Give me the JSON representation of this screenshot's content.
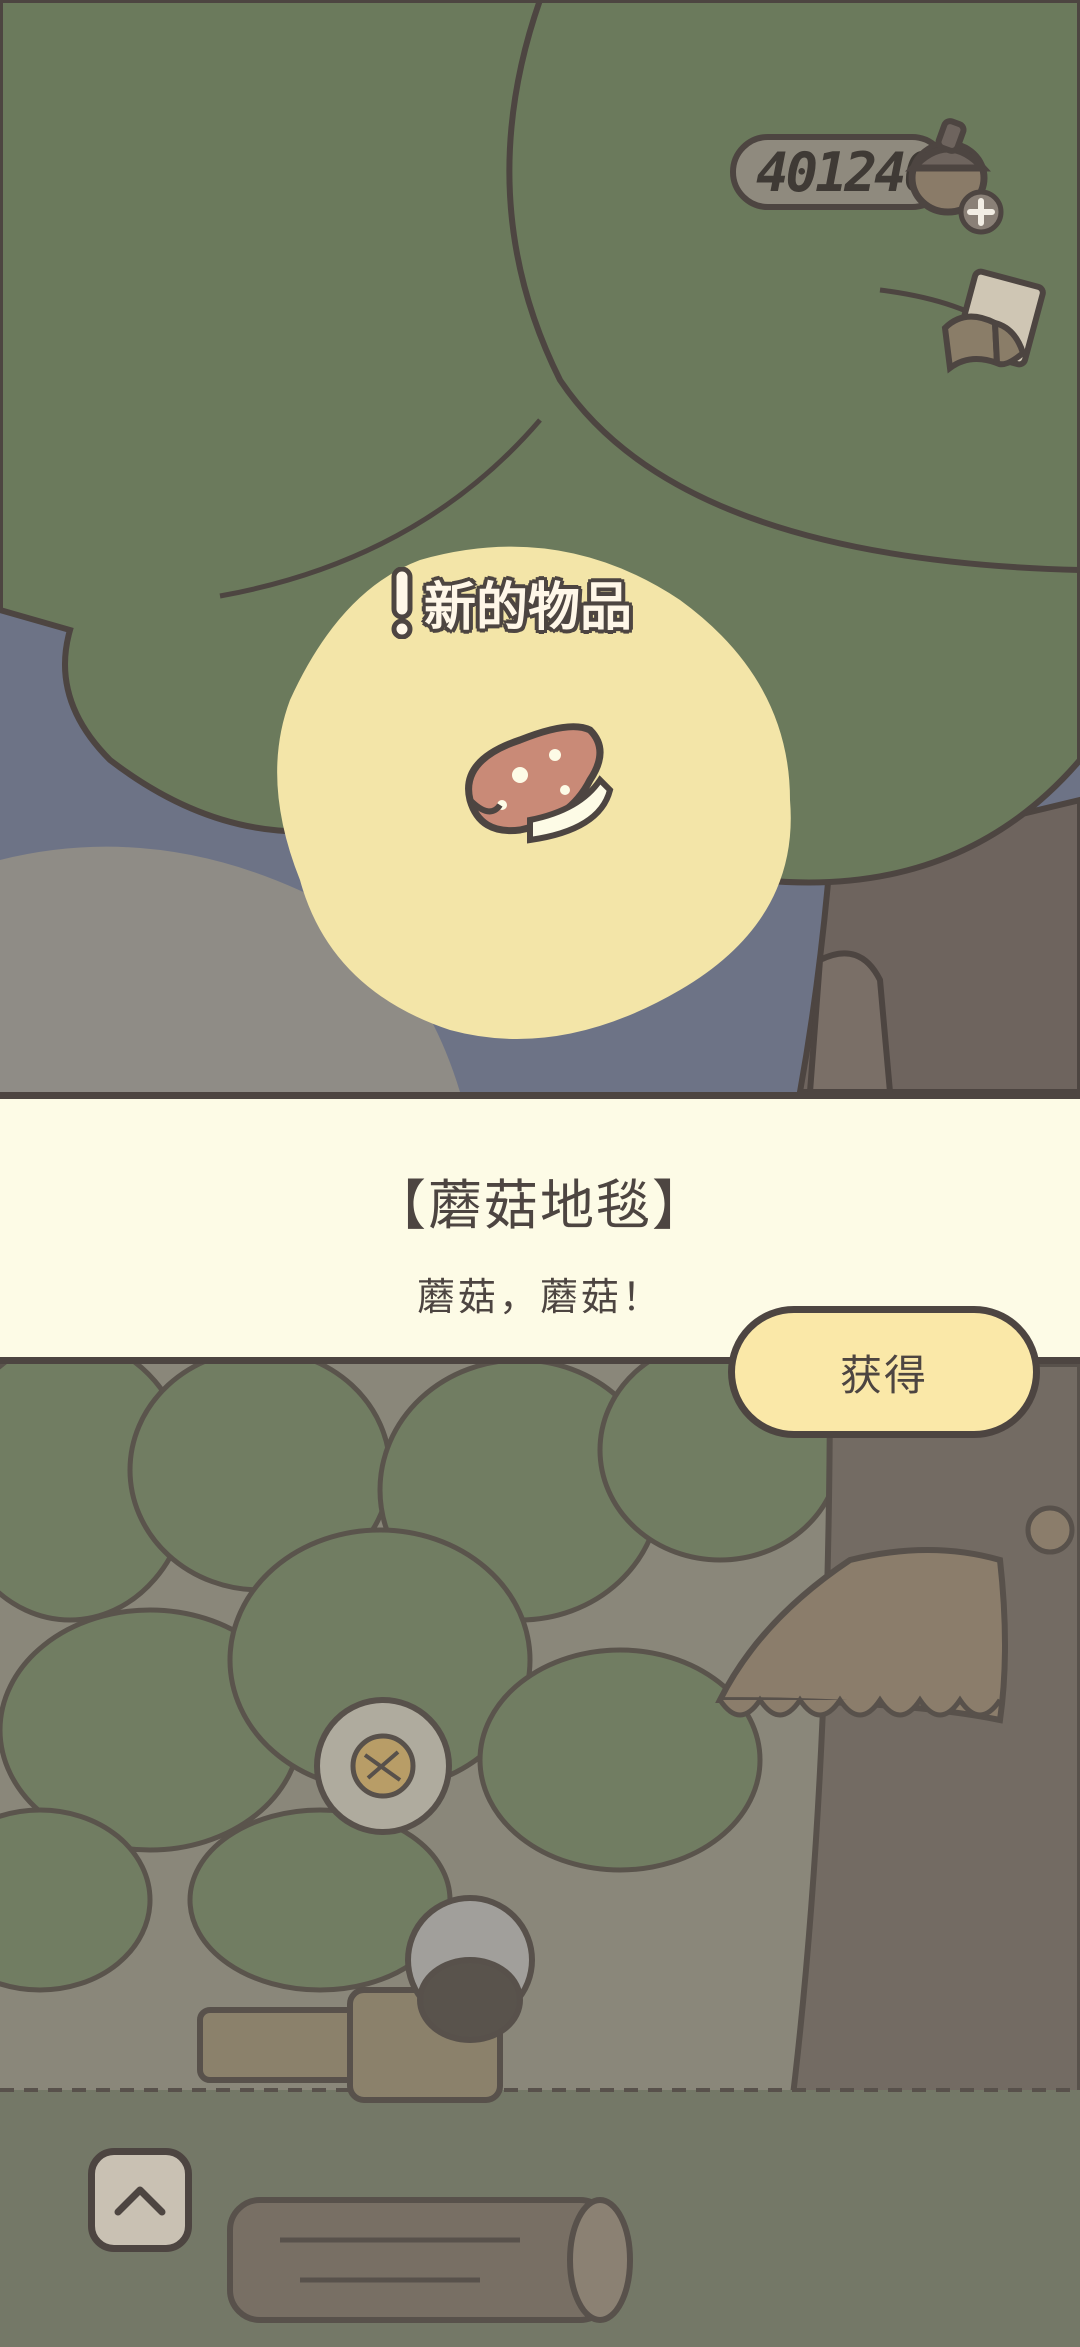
{
  "hud": {
    "currency_value": "401240",
    "currency_icon": "acorn-icon",
    "add_icon": "plus-icon",
    "notebook_icon": "note-icon"
  },
  "popup": {
    "badge_icon": "exclamation-icon",
    "badge_text": "新的物品",
    "item_icon": "mushroom-rug-icon",
    "item_name": "【蘑菇地毯】",
    "item_description": "蘑菇，蘑菇！",
    "obtain_button": "获得"
  },
  "controls": {
    "up_icon": "chevron-up-icon"
  },
  "colors": {
    "tree_green": "#6b7a5c",
    "outline": "#4d4541",
    "glow_yellow": "#f3e5a8",
    "panel_cream": "#fdfbe6",
    "button_yellow": "#fae8a8"
  }
}
